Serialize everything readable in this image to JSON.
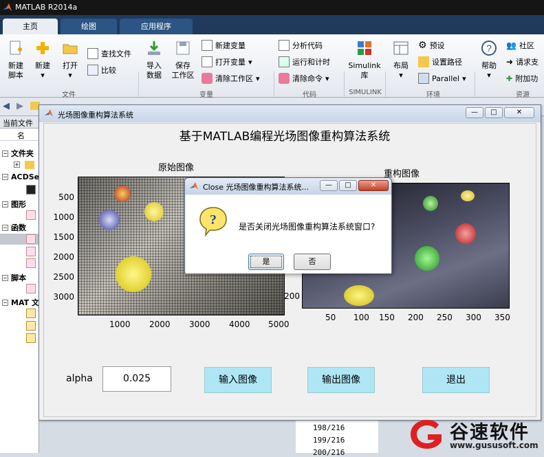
{
  "app": {
    "title": "MATLAB R2014a"
  },
  "tabs": [
    {
      "label": "主页"
    },
    {
      "label": "绘图"
    },
    {
      "label": "应用程序"
    }
  ],
  "ribbon": {
    "new_script": "新建\n脚本",
    "new": "新建",
    "open": "打开",
    "find_files": "查找文件",
    "compare": "比较",
    "import_data": "导入\n数据",
    "save_workspace": "保存\n工作区",
    "new_variable": "新建变量",
    "open_variable": "打开变量",
    "clear_workspace": "清除工作区",
    "analyze_code": "分析代码",
    "run_and_time": "运行和计时",
    "clear_commands": "清除命令",
    "simulink": "Simulink\n库",
    "layout": "布局",
    "preferences": "预设",
    "set_path": "设置路径",
    "parallel": "Parallel",
    "help": "帮助",
    "community": "社区",
    "request_support": "请求支",
    "add_ons": "附加功",
    "groups": {
      "file": "文件",
      "variable": "变量",
      "code": "代码",
      "simulink": "SIMULINK",
      "environment": "环境",
      "resources": "资源"
    }
  },
  "left_pane": {
    "header": "当前文件",
    "col": "名",
    "sections": [
      {
        "label": "文件夹"
      },
      {
        "label": "ACDSe"
      },
      {
        "label": "图形"
      },
      {
        "label": "函数"
      },
      {
        "label": "脚本"
      },
      {
        "label": "MAT 文"
      }
    ]
  },
  "command_window": {
    "lines": [
      "198/216",
      "199/216",
      "200/216"
    ]
  },
  "figure": {
    "window_title": "光场图像重构算法系统",
    "main_title": "基于MATLAB编程光场图像重构算法系统",
    "left_axis": {
      "title": "原始图像",
      "y_ticks": [
        "500",
        "1000",
        "1500",
        "2000",
        "2500",
        "3000"
      ],
      "x_ticks": [
        "1000",
        "2000",
        "3000",
        "4000",
        "5000"
      ]
    },
    "right_axis": {
      "title": "重构图像",
      "y_ticks": [
        "200"
      ],
      "x_ticks": [
        "50",
        "100",
        "150",
        "200",
        "250",
        "300",
        "350"
      ]
    },
    "alpha_label": "alpha",
    "alpha_value": "0.025",
    "btn_input": "输入图像",
    "btn_output": "输出图像",
    "btn_exit": "退出"
  },
  "dialog": {
    "title": "Close 光场图像重构算法系统...",
    "message": "是否关闭光场图像重构算法系统窗口?",
    "yes": "是",
    "no": "否"
  },
  "watermark": {
    "name": "谷速软件",
    "url": "www.gususoft.com"
  }
}
